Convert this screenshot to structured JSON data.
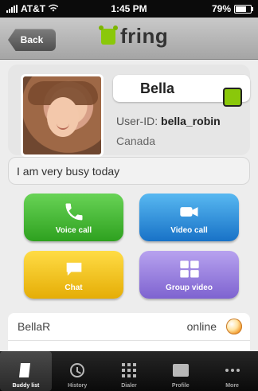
{
  "status_bar": {
    "carrier": "AT&T",
    "time": "1:45 PM",
    "battery": "79%",
    "battery_level": 0.79
  },
  "nav": {
    "back_label": "Back",
    "logo_text": "fring"
  },
  "profile": {
    "name": "Bella",
    "user_id_label": "User-ID:",
    "user_id": "bella_robin",
    "country": "Canada",
    "status_message": "I am very busy today"
  },
  "actions": {
    "voice": "Voice call",
    "video": "Video call",
    "chat": "Chat",
    "group": "Group video"
  },
  "contact": {
    "name": "BellaR",
    "status": "online"
  },
  "tabs": [
    {
      "label": "Buddy list"
    },
    {
      "label": "History"
    },
    {
      "label": "Dialer"
    },
    {
      "label": "Profile"
    },
    {
      "label": "More"
    }
  ],
  "colors": {
    "accent_green": "#8ac80a",
    "voice": "#2ea11f",
    "video": "#1872c7",
    "chat": "#e5ad06",
    "group": "#7e63d0"
  }
}
